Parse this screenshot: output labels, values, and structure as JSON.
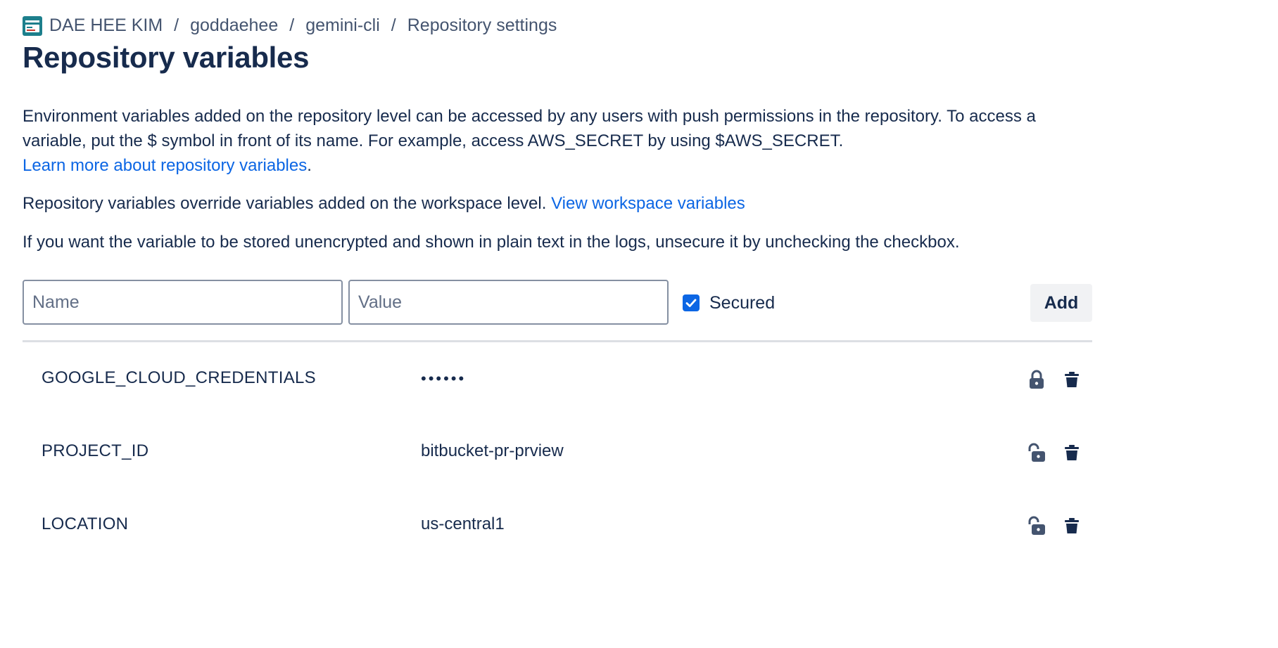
{
  "breadcrumb": {
    "items": [
      "DAE HEE KIM",
      "goddaehee",
      "gemini-cli",
      "Repository settings"
    ],
    "separator": "/"
  },
  "page": {
    "title": "Repository variables"
  },
  "description": {
    "paragraph1": "Environment variables added on the repository level can be accessed by any users with push permissions in the repository. To access a variable, put the $ symbol in front of its name. For example, access AWS_SECRET by using $AWS_SECRET.",
    "learn_more_link": "Learn more about repository variables",
    "learn_more_suffix": ".",
    "paragraph2": "Repository variables override variables added on the workspace level.",
    "workspace_link": "View workspace variables",
    "paragraph3": "If you want the variable to be stored unencrypted and shown in plain text in the logs, unsecure it by unchecking the checkbox."
  },
  "form": {
    "name_placeholder": "Name",
    "value_placeholder": "Value",
    "secured_label": "Secured",
    "secured_checked": true,
    "add_label": "Add"
  },
  "variables": [
    {
      "name": "GOOGLE_CLOUD_CREDENTIALS",
      "value": "••••••",
      "secured": true
    },
    {
      "name": "PROJECT_ID",
      "value": "bitbucket-pr-prview",
      "secured": false
    },
    {
      "name": "LOCATION",
      "value": "us-central1",
      "secured": false
    }
  ],
  "colors": {
    "text": "#172b4d",
    "link": "#0c66e4",
    "icon": "#44546f"
  }
}
